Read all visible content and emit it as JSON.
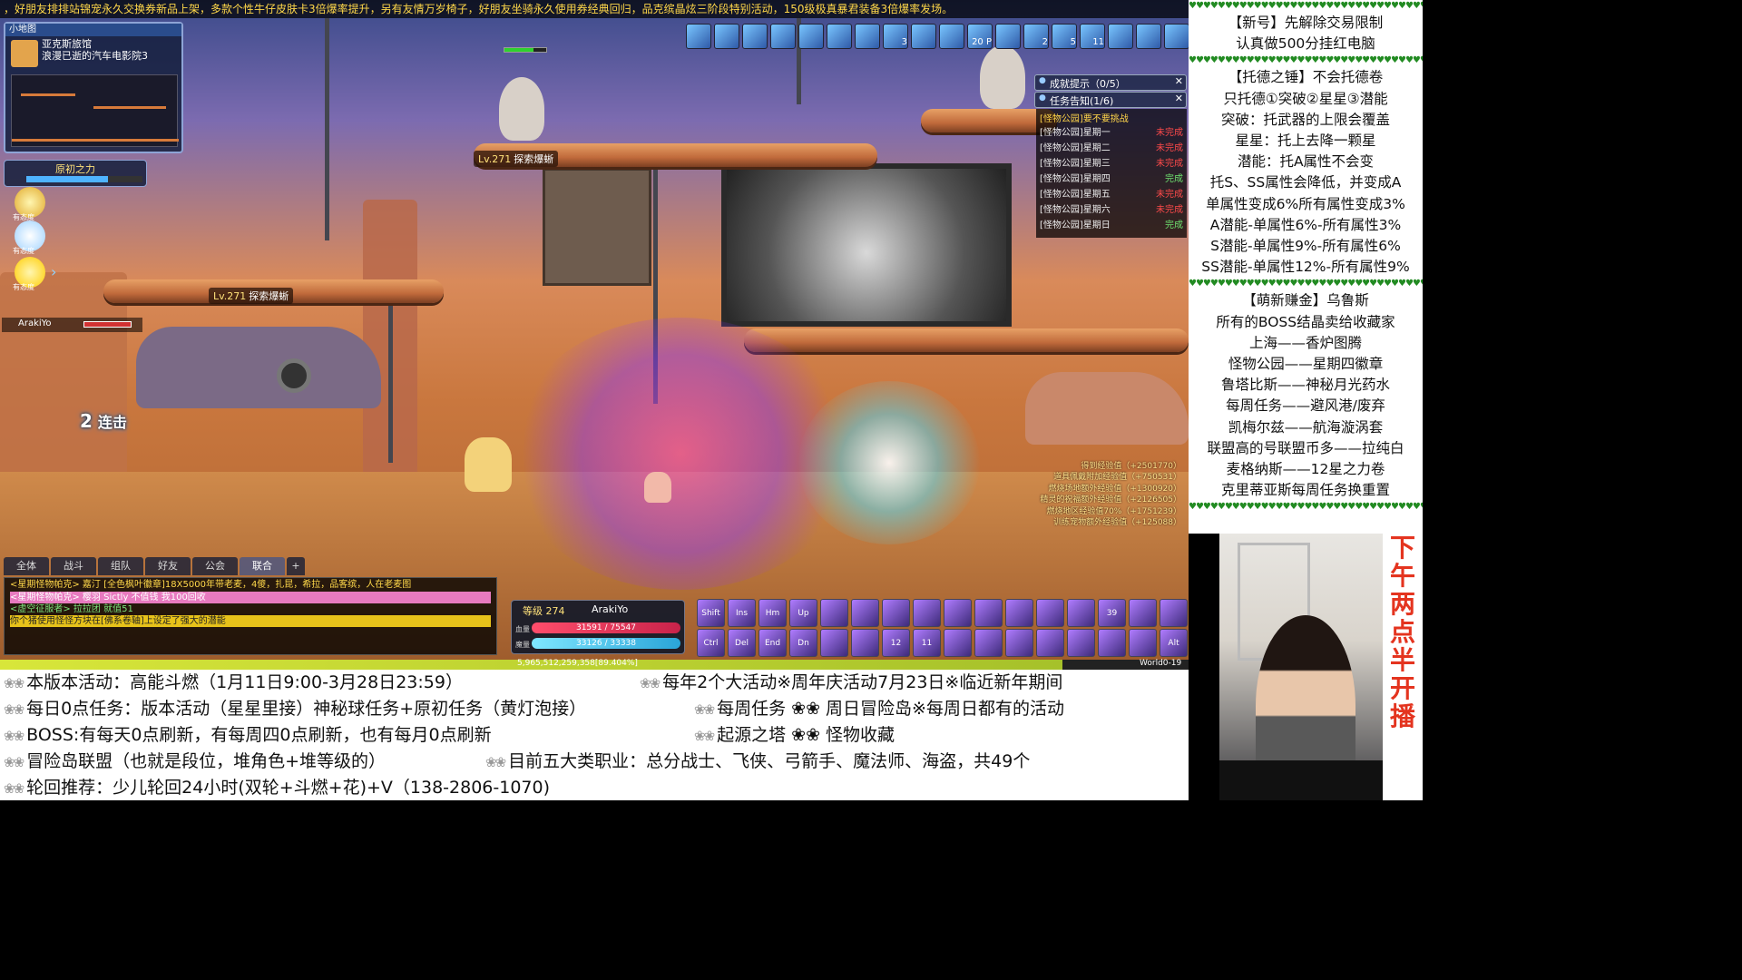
{
  "ticker": "，好朋友排排站锦宠永久交换券新品上架，多款个性牛仔皮肤卡3倍爆率提升，另有友情万岁椅子，好朋友坐骑永久使用券经典回归，品克缤晶炫三阶段特别活动，150级极真暴君装备3倍爆率发场。",
  "minimap": {
    "header": "小地图",
    "region": "亚克斯旅馆",
    "map_name": "浪漫已逝的汽车电影院3"
  },
  "buff_panel": {
    "label": "原初之力",
    "fill": 0.7
  },
  "quick_icons": [
    {
      "name": "trophy-icon",
      "label": "有态度"
    },
    {
      "name": "bulb-icon",
      "label": "有态度"
    },
    {
      "name": "star-icon",
      "label": "有态度"
    }
  ],
  "party": {
    "name": "ArakiYo",
    "hp_fraction": 0.85
  },
  "combo": {
    "count": "2",
    "label": "连击"
  },
  "mobs": [
    {
      "level": "Lv.271",
      "name": "探索爆蜥"
    },
    {
      "level": "Lv.271",
      "name": "探索爆蜥"
    }
  ],
  "top_icons": [
    "",
    "",
    "",
    "",
    "",
    "",
    "",
    "3",
    "",
    "",
    "20 P",
    "",
    "2",
    "5",
    "11",
    "",
    "",
    "",
    ""
  ],
  "achievement_panel": {
    "title": "成就提示（0/5）"
  },
  "quest_panel": {
    "title": "任务告知(1/6)"
  },
  "quest_list": {
    "title": "[怪物公园]要不要挑战",
    "items": [
      {
        "name": "[怪物公园]星期一",
        "status": "未完成"
      },
      {
        "name": "[怪物公园]星期二",
        "status": "未完成"
      },
      {
        "name": "[怪物公园]星期三",
        "status": "未完成"
      },
      {
        "name": "[怪物公园]星期四",
        "status": "完成"
      },
      {
        "name": "[怪物公园]星期五",
        "status": "未完成"
      },
      {
        "name": "[怪物公园]星期六",
        "status": "未完成"
      },
      {
        "name": "[怪物公园]星期日",
        "status": "完成"
      }
    ]
  },
  "exp_log": [
    "得到经验值（+2501770）",
    "道具佩戴附加经验值（+750531）",
    "燃烧场地额外经验值（+1300920）",
    "精灵的祝福额外经验值（+2126505）",
    "燃烧地区经验值70%（+1751239）",
    "训练宠物额外经验值（+125088）"
  ],
  "chat_tabs": [
    "全体",
    "战斗",
    "组队",
    "好友",
    "公会",
    "联合",
    "+"
  ],
  "chat": {
    "line1": "<星期怪物帕克> 嘉汀 [全色枫叶徽章]18X5000年带老麦，4傻，扎昆，希拉，品客缤，人在老麦图",
    "line2": "<星期怪物帕克> 樱羽 Sictly 不值钱 我100回收",
    "line3": "<虚空征服者> 拉拉团 就值51",
    "line4": "你个猪使用怪怪方块在[佛系卷轴]上设定了强大的潜能"
  },
  "status": {
    "level": "等级 274",
    "name": "ArakiYo",
    "hp_label": "血量",
    "mp_label": "魔量",
    "hp": "31591 / 75547",
    "mp": "33126 / 33338"
  },
  "skill_bar": [
    "Shift",
    "Ins",
    "Hm",
    "Up",
    "",
    "",
    "",
    "",
    "",
    "",
    "",
    "",
    "",
    "39",
    "",
    "",
    "Ctrl",
    "Del",
    "End",
    "Dn",
    "",
    "",
    "12",
    "11",
    "",
    "",
    "",
    "",
    "",
    "",
    "",
    "Alt"
  ],
  "exp_bar": {
    "text": "5,965,512,259,358[89.404%]",
    "fraction": 0.894,
    "channel": "World0-19"
  },
  "right_panel": {
    "lines": [
      "【新号】先解除交易限制",
      "认真做500分挂红电脑",
      "【托德之锤】不会托德卷",
      "只托德①突破②星星③潜能",
      "突破：托武器的上限会覆盖",
      "星星：托上去降一颗星",
      "潜能：托A属性不会变",
      "托S、SS属性会降低，并变成A",
      "单属性变成6%所有属性变成3%",
      "A潜能-单属性6%-所有属性3%",
      "S潜能-单属性9%-所有属性6%",
      "SS潜能-单属性12%-所有属性9%",
      "【萌新赚金】乌鲁斯",
      "所有的BOSS结晶卖给收藏家",
      "上海——香炉图腾",
      "怪物公园——星期四徽章",
      "鲁塔比斯——神秘月光药水",
      "每周任务——避风港/废弃",
      "凯梅尔兹——航海漩涡套",
      "联盟高的号联盟币多——拉纯白",
      "麦格纳斯——12星之力卷",
      "克里蒂亚斯每周任务换重置"
    ],
    "hearts": "♥♥♥♥♥♥♥♥♥♥♥♥♥♥♥♥♥♥♥♥♥♥♥♥♥♥♥♥♥♥♥♥♥♥♥"
  },
  "stream_side": [
    "下",
    "午",
    "两",
    "点",
    "半",
    "开",
    "播"
  ],
  "bottom_rows": [
    {
      "left": "本版本活动：高能斗燃（1月11日9:00-3月28日23:59）",
      "right": "每年2个大活动※周年庆活动7月23日※临近新年期间"
    },
    {
      "left": "每日0点任务：版本活动（星星里接）神秘球任务+原初任务（黄灯泡接）",
      "right": "每周任务 ❀❀ 周日冒险岛※每周日都有的活动"
    },
    {
      "left": "BOSS:有每天0点刷新，有每周四0点刷新，也有每月0点刷新",
      "right": "起源之塔 ❀❀ 怪物收藏"
    },
    {
      "left": "冒险岛联盟（也就是段位，堆角色+堆等级的）",
      "right": "目前五大类职业：总分战士、飞侠、弓箭手、魔法师、海盗，共49个"
    },
    {
      "left": "轮回推荐：少儿轮回24小时(双轮+斗燃+花)+V（138-2806-1070)",
      "right": ""
    }
  ],
  "flower": "❀❀"
}
